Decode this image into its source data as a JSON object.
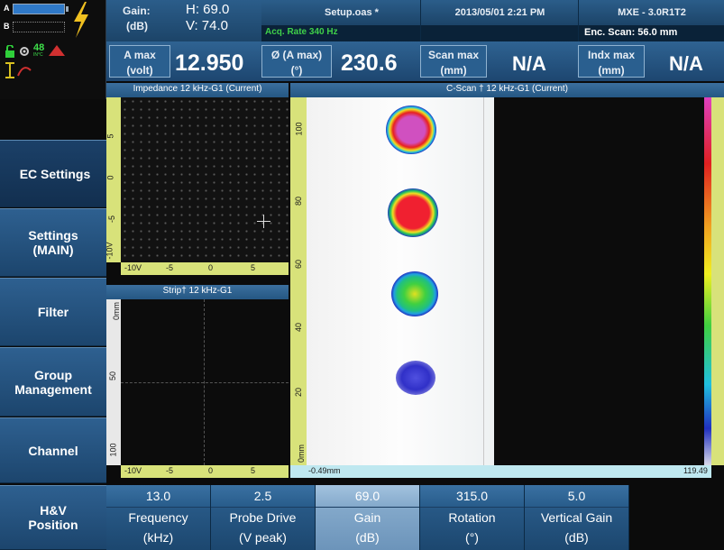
{
  "status": {
    "battery_a": "A",
    "battery_b": "B",
    "temp": "48",
    "temp_unit": "IN°C"
  },
  "header": {
    "gain_label": "Gain:",
    "gain_unit": "(dB)",
    "gain_h": "H: 69.0",
    "gain_v": "V: 74.0",
    "setup": "Setup.oas *",
    "acq_rate": "Acq. Rate 340  Hz",
    "datetime": "2013/05/01 2:21 PM",
    "model": "MXE - 3.0R1T2",
    "enc_scan": "Enc. Scan:  56.0 mm",
    "amax_label": "A max",
    "amax_unit": "(volt)",
    "amax_value": "12.950",
    "phase_label": "Ø (A max)",
    "phase_unit": "(°)",
    "phase_value": "230.6",
    "scanmax_label": "Scan max",
    "scanmax_unit": "(mm)",
    "scanmax_value": "N/A",
    "indxmax_label": "Indx max",
    "indxmax_unit": "(mm)",
    "indxmax_value": "N/A"
  },
  "menu": {
    "items": [
      {
        "label": "EC Settings"
      },
      {
        "label": "Settings (MAIN)"
      },
      {
        "label": "Filter"
      },
      {
        "label": "Group Management"
      },
      {
        "label": "Channel"
      },
      {
        "label": "H&V Position"
      }
    ]
  },
  "impedance": {
    "title": "Impedance 12 kHz-G1 (Current)",
    "vticks": [
      "5",
      "0",
      "-5",
      "-10V"
    ],
    "hticks": [
      "-10V",
      "-5",
      "0",
      "5"
    ]
  },
  "strip": {
    "title": "Strip† 12 kHz-G1",
    "vticks": [
      "0mm",
      "50",
      "100"
    ],
    "hticks": [
      "-10V",
      "-5",
      "0",
      "5"
    ]
  },
  "cscan": {
    "title": "C-Scan † 12 kHz-G1 (Current)",
    "vticks": [
      "100",
      "80",
      "60",
      "40",
      "20",
      "0mm"
    ],
    "hstart": "-0.49mm",
    "hend": "119.49"
  },
  "params": [
    {
      "value": "13.0",
      "name": "Frequency",
      "unit": "(kHz)"
    },
    {
      "value": "2.5",
      "name": "Probe Drive",
      "unit": "(V peak)"
    },
    {
      "value": "69.0",
      "name": "Gain",
      "unit": "(dB)"
    },
    {
      "value": "315.0",
      "name": "Rotation",
      "unit": "(°)"
    },
    {
      "value": "5.0",
      "name": "Vertical Gain",
      "unit": "(dB)"
    }
  ],
  "colors": {
    "accent": "#2b5d8a",
    "ruler": "#d8e27a",
    "selected": "#8fb3d3"
  }
}
